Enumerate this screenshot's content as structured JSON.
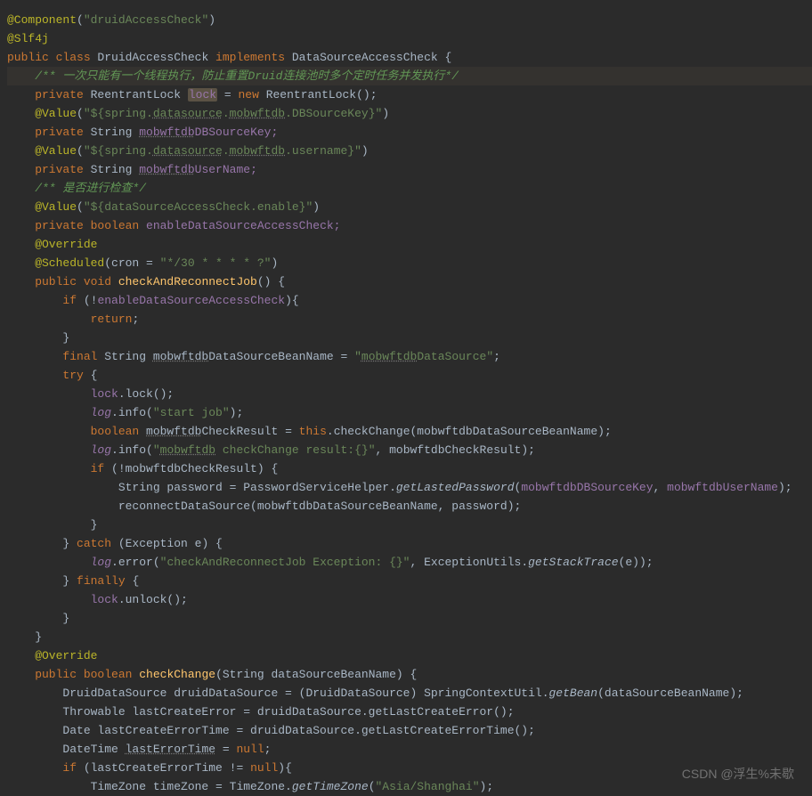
{
  "watermark": "CSDN @浮生%未歇",
  "code": {
    "l1a": "@Component",
    "l1b": "(",
    "l1c": "\"druidAccessCheck\"",
    "l1d": ")",
    "l2": "@Slf4j",
    "l3a": "public class ",
    "l3b": "DruidAccessCheck ",
    "l3c": "implements ",
    "l3d": "DataSourceAccessCheck {",
    "l4a": "    /** ",
    "l4b": "一次只能有一个线程执行，防止重置Druid连接池时多个定时任务并发执行*/",
    "l5a": "    private ",
    "l5b": "ReentrantLock ",
    "l5c": "lock",
    "l5d": " = ",
    "l5e": "new ",
    "l5f": "ReentrantLock();",
    "l6a": "    @Value",
    "l6b": "(",
    "l6c": "\"${spring.",
    "l6d": "datasource",
    "l6e": ".",
    "l6f": "mobwftdb",
    "l6g": ".DBSourceKey}\"",
    "l6h": ")",
    "l7a": "    private ",
    "l7b": "String ",
    "l7c": "mobwftdb",
    "l7d": "DBSourceKey;",
    "l8a": "    @Value",
    "l8b": "(",
    "l8c": "\"${spring.",
    "l8d": "datasource",
    "l8e": ".",
    "l8f": "mobwftdb",
    "l8g": ".username}\"",
    "l8h": ")",
    "l9a": "    private ",
    "l9b": "String ",
    "l9c": "mobwftdb",
    "l9d": "UserName;",
    "l10": "    /** 是否进行检查*/",
    "l11a": "    @Value",
    "l11b": "(",
    "l11c": "\"${dataSourceAccessCheck.enable}\"",
    "l11d": ")",
    "l12a": "    private boolean ",
    "l12b": "enableDataSourceAccessCheck;",
    "l13": "    @Override",
    "l14a": "    @Scheduled",
    "l14b": "(cron = ",
    "l14c": "\"*/30 * * * * ?\"",
    "l14d": ")",
    "l15a": "    public void ",
    "l15b": "checkAndReconnectJob",
    "l15c": "() {",
    "l16a": "        if ",
    "l16b": "(!",
    "l16c": "enableDataSourceAccessCheck",
    "l16d": "){",
    "l17a": "            return",
    "l17b": ";",
    "l18": "        }",
    "l19a": "        final ",
    "l19b": "String ",
    "l19c": "mobwftdb",
    "l19d": "DataSourceBeanName = ",
    "l19e": "\"",
    "l19f": "mobwftdb",
    "l19g": "DataSource\"",
    "l19h": ";",
    "l20a": "        try ",
    "l20b": "{",
    "l21a": "            lock",
    "l21b": ".lock();",
    "l22a": "            log",
    "l22b": ".info(",
    "l22c": "\"start job\"",
    "l22d": ");",
    "l23a": "            boolean ",
    "l23b": "mobwftdb",
    "l23c": "CheckResult = ",
    "l23d": "this",
    "l23e": ".checkChange(mobwftdbDataSourceBeanName);",
    "l24a": "            log",
    "l24b": ".info(",
    "l24c": "\"",
    "l24d": "mobwftdb",
    "l24e": " checkChange result:{}\"",
    "l24f": ", mobwftdbCheckResult);",
    "l25a": "            if ",
    "l25b": "(!mobwftdbCheckResult) {",
    "l26a": "                String password = PasswordServiceHelper.",
    "l26b": "getLastedPassword",
    "l26c": "(",
    "l26d": "mobwftdbDBSourceKey",
    "l26e": ", ",
    "l26f": "mobwftdbUserName",
    "l26g": ");",
    "l27": "                reconnectDataSource(mobwftdbDataSourceBeanName, password);",
    "l28": "            }",
    "l29a": "        } ",
    "l29b": "catch ",
    "l29c": "(Exception e) {",
    "l30a": "            log",
    "l30b": ".error(",
    "l30c": "\"checkAndReconnectJob Exception: {}\"",
    "l30d": ", ExceptionUtils.",
    "l30e": "getStackTrace",
    "l30f": "(e));",
    "l31a": "        } ",
    "l31b": "finally ",
    "l31c": "{",
    "l32a": "            lock",
    "l32b": ".unlock();",
    "l33": "        }",
    "l34": "    }",
    "l35": "    @Override",
    "l36a": "    public boolean ",
    "l36b": "checkChange",
    "l36c": "(String dataSourceBeanName) {",
    "l37a": "        DruidDataSource druidDataSource = (DruidDataSource) SpringContextUtil.",
    "l37b": "getBean",
    "l37c": "(dataSourceBeanName);",
    "l38": "        Throwable lastCreateError = druidDataSource.getLastCreateError();",
    "l39": "        Date lastCreateErrorTime = druidDataSource.getLastCreateErrorTime();",
    "l40a": "        DateTime ",
    "l40b": "lastErrorTime",
    "l40c": " = ",
    "l40d": "null",
    "l40e": ";",
    "l41a": "        if ",
    "l41b": "(lastCreateErrorTime != ",
    "l41c": "null",
    "l41d": "){",
    "l42a": "            TimeZone timeZone = TimeZone.",
    "l42b": "getTimeZone",
    "l42c": "(",
    "l42d": "\"Asia/Shanghai\"",
    "l42e": ");"
  }
}
